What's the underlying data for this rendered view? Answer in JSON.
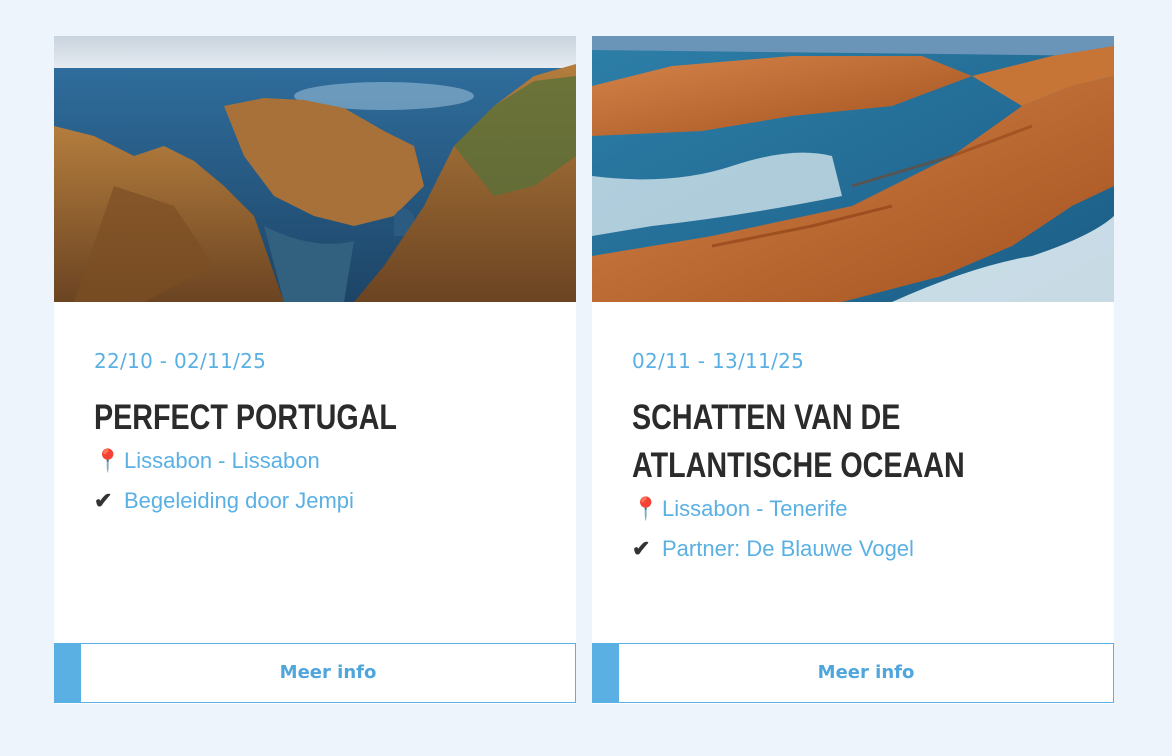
{
  "cards": [
    {
      "dates": "22/10 - 02/11/25",
      "title": "PERFECT PORTUGAL",
      "route_icon": "📍",
      "route": "Lissabon - Lissabon",
      "guide_icon": "✔",
      "guide": "Begeleiding door Jempi",
      "button": "Meer info",
      "image": "cliffs-arch-sea-photo"
    },
    {
      "dates": "02/11 - 13/11/25",
      "title": "SCHATTEN VAN DE ATLANTISCHE OCEAAN",
      "route_icon": "📍",
      "route": "Lissabon - Tenerife",
      "guide_icon": "✔",
      "guide": "Partner: De Blauwe Vogel",
      "button": "Meer info",
      "image": "orange-rocks-waves-photo"
    }
  ],
  "colors": {
    "accent": "#5ab0e3",
    "title": "#2b2b2b",
    "background": "#edf4fc"
  }
}
